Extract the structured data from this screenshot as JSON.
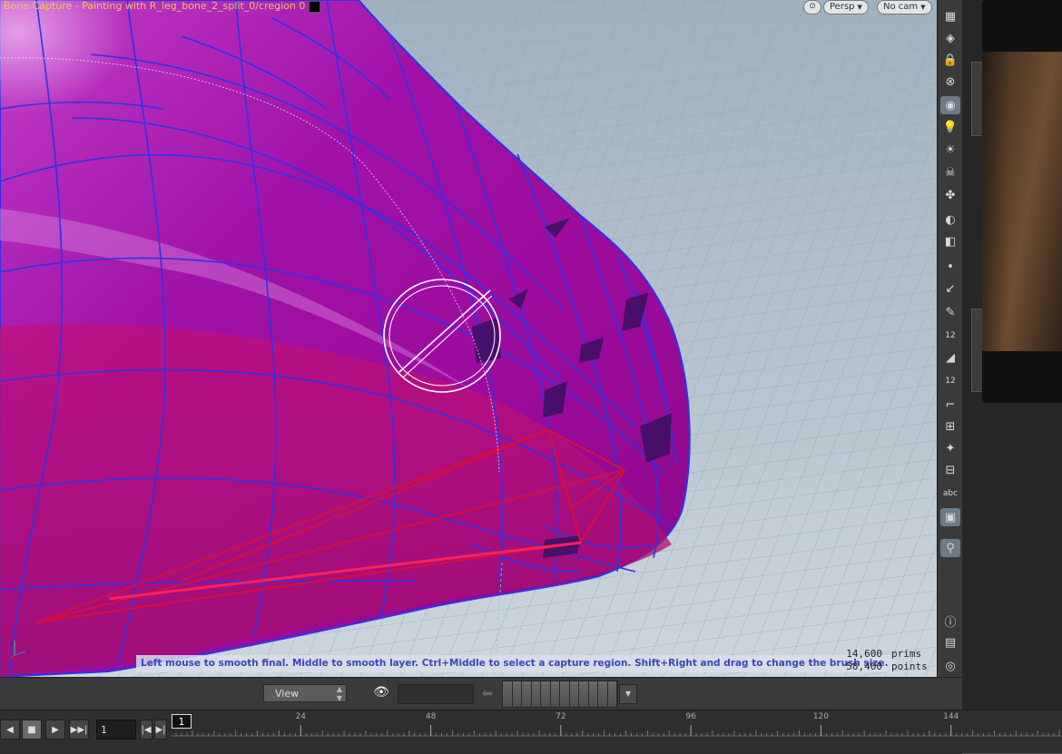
{
  "viewport": {
    "title": "Bone Capture - Painting with R_leg_bone_2_split_0/cregion 0",
    "camera_mode": "Persp",
    "camera": "No cam",
    "hint": "Left mouse to smooth final.  Middle to smooth layer.  Ctrl+Middle to select a capture region.  Shift+Right and drag to change the brush size.",
    "stats": [
      {
        "value": "14,600",
        "label": "prims"
      },
      {
        "value": "58,400",
        "label": "points"
      }
    ],
    "axes": {
      "y": "y",
      "z": "z"
    }
  },
  "shelf": {
    "items": [
      {
        "icon": "view-display-icon",
        "glyph": "▦"
      },
      {
        "icon": "render-icon",
        "glyph": "◈"
      },
      {
        "icon": "lock-icon",
        "glyph": "🔒"
      },
      {
        "icon": "snap-icon",
        "glyph": "⊗"
      },
      {
        "icon": "ghost-icon",
        "glyph": "◉"
      },
      {
        "icon": "light-icon",
        "glyph": "💡"
      },
      {
        "icon": "light-add-icon",
        "glyph": "☀"
      },
      {
        "icon": "skull-icon",
        "glyph": "☠"
      },
      {
        "icon": "nodes-icon",
        "glyph": "✤"
      },
      {
        "icon": "eye-toggle-icon",
        "glyph": "◐"
      },
      {
        "icon": "selection-icon",
        "glyph": "◧"
      },
      {
        "icon": "point-icon",
        "glyph": "•"
      },
      {
        "icon": "edge-icon",
        "glyph": "↙"
      },
      {
        "icon": "pen-icon",
        "glyph": "✎"
      },
      {
        "icon": "point-numbers-icon",
        "glyph": "12"
      },
      {
        "icon": "prim-icon",
        "glyph": "◢"
      },
      {
        "icon": "prim-numbers-icon",
        "glyph": "12"
      },
      {
        "icon": "corner-icon",
        "glyph": "⌐"
      },
      {
        "icon": "grid-snap-icon",
        "glyph": "⊞"
      },
      {
        "icon": "handle-icon",
        "glyph": "✦"
      },
      {
        "icon": "wire-icon",
        "glyph": "⊟"
      },
      {
        "icon": "text-label",
        "glyph": "abc"
      },
      {
        "icon": "background-icon",
        "glyph": "▣"
      },
      {
        "icon": "pin-icon",
        "glyph": "⚲"
      },
      {
        "icon": "info-icon",
        "glyph": "ⓘ"
      },
      {
        "icon": "layers-icon",
        "glyph": "▤"
      },
      {
        "icon": "camera-view-icon",
        "glyph": "◎"
      }
    ]
  },
  "viewport_bar": {
    "view_label": "View"
  },
  "timeline": {
    "current_frame": "1",
    "cursor_frame": "1",
    "ticks": [
      "24",
      "48",
      "72",
      "96",
      "120",
      "144"
    ]
  },
  "colors": {
    "mesh_fill": "#a416a6",
    "wire": "#2d34e6",
    "bone": "#e0104a",
    "accent_title": "#e7c84a"
  }
}
